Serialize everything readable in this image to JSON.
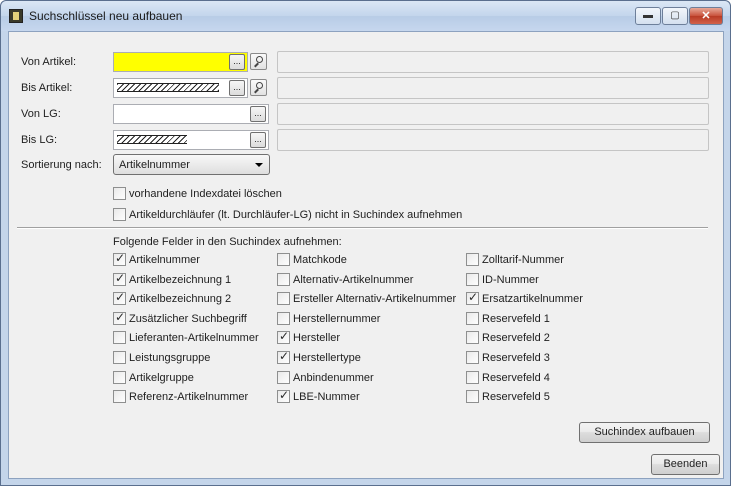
{
  "window": {
    "title": "Suchschlüssel neu aufbauen",
    "controls": {
      "minimize": "▬",
      "maximize": "▢",
      "close": "✕"
    }
  },
  "form": {
    "von_artikel_label": "Von Artikel:",
    "bis_artikel_label": "Bis Artikel:",
    "von_lg_label": "Von LG:",
    "bis_lg_label": "Bis LG:",
    "sortierung_label": "Sortierung nach:",
    "sortierung_value": "Artikelnummer",
    "browse_label": "...",
    "highlight_color": "#ffff00"
  },
  "options": {
    "delete_index": {
      "label": "vorhandene Indexdatei löschen",
      "checked": false
    },
    "exclude_durchlaeufer": {
      "label": "Artikeldurchläufer (lt. Durchläufer-LG) nicht in Suchindex aufnehmen",
      "checked": false
    }
  },
  "fields_section": {
    "heading": "Folgende Felder in den Suchindex aufnehmen:",
    "columns": [
      [
        {
          "label": "Artikelnummer",
          "checked": true
        },
        {
          "label": "Artikelbezeichnung 1",
          "checked": true
        },
        {
          "label": "Artikelbezeichnung 2",
          "checked": true
        },
        {
          "label": "Zusätzlicher Suchbegriff",
          "checked": true
        },
        {
          "label": "Lieferanten-Artikelnummer",
          "checked": false
        },
        {
          "label": "Leistungsgruppe",
          "checked": false
        },
        {
          "label": "Artikelgruppe",
          "checked": false
        },
        {
          "label": "Referenz-Artikelnummer",
          "checked": false
        }
      ],
      [
        {
          "label": "Matchkode",
          "checked": false
        },
        {
          "label": "Alternativ-Artikelnummer",
          "checked": false
        },
        {
          "label": "Ersteller Alternativ-Artikelnummer",
          "checked": false
        },
        {
          "label": "Herstellernummer",
          "checked": false
        },
        {
          "label": "Hersteller",
          "checked": true
        },
        {
          "label": "Herstellertype",
          "checked": true
        },
        {
          "label": "Anbindenummer",
          "checked": false
        },
        {
          "label": "LBE-Nummer",
          "checked": true
        }
      ],
      [
        {
          "label": "Zolltarif-Nummer",
          "checked": false
        },
        {
          "label": "ID-Nummer",
          "checked": false
        },
        {
          "label": "Ersatzartikelnummer",
          "checked": true
        },
        {
          "label": "Reservefeld 1",
          "checked": false
        },
        {
          "label": "Reservefeld 2",
          "checked": false
        },
        {
          "label": "Reservefeld 3",
          "checked": false
        },
        {
          "label": "Reservefeld 4",
          "checked": false
        },
        {
          "label": "Reservefeld 5",
          "checked": false
        }
      ]
    ]
  },
  "buttons": {
    "build_index": "Suchindex aufbauen",
    "close": "Beenden"
  }
}
